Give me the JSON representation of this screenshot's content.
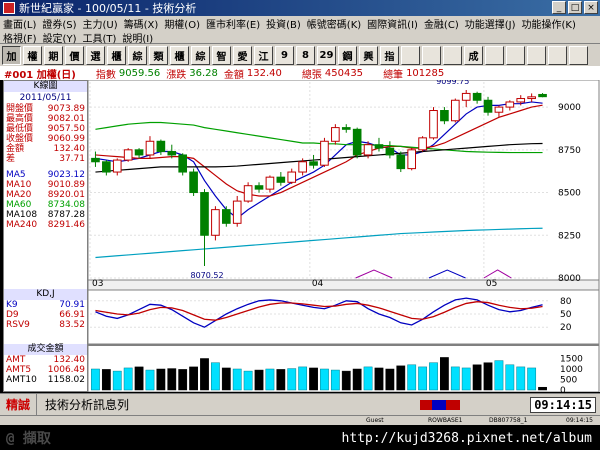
{
  "window": {
    "title": "新世紀贏家 - 100/05/11 - 技術分析",
    "controls": [
      "_",
      "□",
      "×"
    ]
  },
  "menu": {
    "row1": [
      "畫面(L)",
      "證券(S)",
      "主力(U)",
      "籌碼(X)",
      "期權(O)",
      "匯市利率(E)",
      "投資(B)",
      "帳號密碼(K)",
      "國際資訊(I)",
      "金融(C)",
      "功能選擇(J)",
      "功能操作(K)"
    ],
    "row2": [
      "格視(F)",
      "設定(Y)",
      "工具(T)",
      "說明(I)"
    ]
  },
  "toolbar": {
    "buttons": [
      "加",
      "權",
      "期",
      "價",
      "選",
      "櫃",
      "綜",
      "類",
      "櫃",
      "綜",
      "智",
      "愛",
      "江",
      "9",
      "8",
      "29",
      "鋼",
      "興",
      "指",
      "",
      "",
      "",
      "成",
      "",
      "",
      "",
      "",
      ""
    ]
  },
  "info": {
    "code": "#001 加權(日)",
    "index_label": "指數",
    "index_value": "9059.56",
    "change_label": "漲跌",
    "change_value": "36.28",
    "amount_label": "金額",
    "amount_value": "132.40",
    "vol_label": "總張",
    "vol_value": "450435",
    "trades_label": "總筆",
    "trades_value": "101285"
  },
  "k_panel": {
    "title": "K線圖",
    "date": "2011/05/11",
    "rows": [
      {
        "label": "開盤價",
        "value": "9073.89",
        "color": "#c00000"
      },
      {
        "label": "最高價",
        "value": "9082.01",
        "color": "#c00000"
      },
      {
        "label": "最低價",
        "value": "9057.50",
        "color": "#c00000"
      },
      {
        "label": "收盤價",
        "value": "9060.99",
        "color": "#c00000"
      },
      {
        "label": "金額",
        "value": "132.40",
        "color": "#c00000"
      },
      {
        "label": "差",
        "value": "37.71",
        "color": "#c00000"
      }
    ],
    "ma_rows": [
      {
        "label": "MA5",
        "value": "9023.12",
        "color": "#0000c0"
      },
      {
        "label": "MA10",
        "value": "9010.89",
        "color": "#c00000"
      },
      {
        "label": "MA20",
        "value": "8920.01",
        "color": "#c00000"
      },
      {
        "label": "MA60",
        "value": "8734.08",
        "color": "#00a000"
      },
      {
        "label": "MA108",
        "value": "8787.28",
        "color": "#000000"
      },
      {
        "label": "MA240",
        "value": "8291.46",
        "color": "#c00000"
      }
    ],
    "kd_title": "KD,J",
    "kd_rows": [
      {
        "label": "K9",
        "value": "70.91",
        "color": "#0000c0"
      },
      {
        "label": "D9",
        "value": "66.91",
        "color": "#c00000"
      },
      {
        "label": "RSV9",
        "value": "83.52",
        "color": "#c00000"
      }
    ],
    "vol_title": "成交金額",
    "vol_rows": [
      {
        "label": "AMT",
        "value": "132.40",
        "color": "#c00000"
      },
      {
        "label": "AMT5",
        "value": "1006.49",
        "color": "#c00000"
      },
      {
        "label": "AMT10",
        "value": "1158.02",
        "color": "#000000"
      }
    ]
  },
  "chart_data": [
    {
      "type": "candlestick",
      "title": "K線圖",
      "x_labels": [
        "03",
        "04",
        "05"
      ],
      "y_ticks": [
        8000,
        8250,
        8500,
        8750,
        9000
      ],
      "ylim": [
        8000,
        9100
      ],
      "annotations": [
        {
          "text": "9099.75"
        },
        {
          "text": "8070.52"
        }
      ],
      "candles": [
        [
          8700,
          8740,
          8650,
          8680
        ],
        [
          8680,
          8690,
          8600,
          8620
        ],
        [
          8620,
          8700,
          8600,
          8690
        ],
        [
          8690,
          8760,
          8680,
          8750
        ],
        [
          8750,
          8760,
          8700,
          8720
        ],
        [
          8720,
          8830,
          8700,
          8800
        ],
        [
          8800,
          8810,
          8720,
          8740
        ],
        [
          8740,
          8780,
          8700,
          8720
        ],
        [
          8720,
          8730,
          8600,
          8620
        ],
        [
          8620,
          8640,
          8480,
          8500
        ],
        [
          8500,
          8520,
          8070,
          8250
        ],
        [
          8250,
          8420,
          8220,
          8400
        ],
        [
          8400,
          8420,
          8300,
          8320
        ],
        [
          8320,
          8480,
          8300,
          8450
        ],
        [
          8450,
          8560,
          8440,
          8540
        ],
        [
          8540,
          8560,
          8500,
          8520
        ],
        [
          8520,
          8600,
          8500,
          8590
        ],
        [
          8590,
          8620,
          8540,
          8560
        ],
        [
          8560,
          8640,
          8550,
          8620
        ],
        [
          8620,
          8700,
          8600,
          8680
        ],
        [
          8680,
          8720,
          8640,
          8660
        ],
        [
          8660,
          8820,
          8650,
          8800
        ],
        [
          8800,
          8900,
          8780,
          8880
        ],
        [
          8880,
          8900,
          8850,
          8870
        ],
        [
          8870,
          8880,
          8700,
          8720
        ],
        [
          8720,
          8800,
          8700,
          8780
        ],
        [
          8780,
          8820,
          8740,
          8760
        ],
        [
          8760,
          8800,
          8700,
          8720
        ],
        [
          8720,
          8740,
          8620,
          8640
        ],
        [
          8640,
          8760,
          8630,
          8750
        ],
        [
          8750,
          8830,
          8740,
          8820
        ],
        [
          8820,
          9000,
          8810,
          8980
        ],
        [
          8980,
          9000,
          8900,
          8920
        ],
        [
          8920,
          9050,
          8910,
          9040
        ],
        [
          9040,
          9100,
          9000,
          9080
        ],
        [
          9080,
          9090,
          9020,
          9040
        ],
        [
          9040,
          9060,
          8950,
          8970
        ],
        [
          8970,
          9010,
          8940,
          9000
        ],
        [
          9000,
          9040,
          8980,
          9030
        ],
        [
          9030,
          9070,
          9010,
          9050
        ],
        [
          9050,
          9080,
          9030,
          9060
        ],
        [
          9073.89,
          9082.01,
          9057.5,
          9060.99
        ]
      ],
      "ma": [
        {
          "name": "MA5",
          "color": "#0000c0",
          "values": [
            8700,
            8690,
            8680,
            8690,
            8700,
            8720,
            8740,
            8740,
            8720,
            8680,
            8570,
            8480,
            8400,
            8350,
            8400,
            8440,
            8480,
            8520,
            8560,
            8590,
            8620,
            8660,
            8720,
            8780,
            8800,
            8790,
            8770,
            8760,
            8720,
            8720,
            8740,
            8780,
            8840,
            8900,
            8960,
            9000,
            9010,
            9010,
            9020,
            9020,
            9030,
            9023
          ]
        },
        {
          "name": "MA10",
          "color": "#c00000",
          "values": [
            8720,
            8715,
            8710,
            8705,
            8700,
            8700,
            8705,
            8710,
            8710,
            8700,
            8650,
            8600,
            8550,
            8510,
            8490,
            8480,
            8480,
            8500,
            8530,
            8560,
            8590,
            8620,
            8650,
            8680,
            8720,
            8740,
            8760,
            8770,
            8770,
            8760,
            8760,
            8770,
            8790,
            8820,
            8850,
            8880,
            8910,
            8940,
            8960,
            8980,
            9000,
            9011
          ]
        },
        {
          "name": "MA60",
          "color": "#00a000",
          "values": [
            8870,
            8880,
            8890,
            8900,
            8905,
            8910,
            8910,
            8905,
            8900,
            8895,
            8880,
            8870,
            8860,
            8850,
            8840,
            8830,
            8820,
            8810,
            8800,
            8790,
            8790,
            8785,
            8785,
            8780,
            8780,
            8780,
            8775,
            8775,
            8770,
            8765,
            8760,
            8755,
            8750,
            8745,
            8740,
            8738,
            8736,
            8735,
            8734,
            8734,
            8734,
            8734
          ]
        },
        {
          "name": "MA108",
          "color": "#000000",
          "values": [
            8620,
            8625,
            8630,
            8635,
            8640,
            8645,
            8650,
            8650,
            8650,
            8650,
            8650,
            8650,
            8652,
            8655,
            8660,
            8665,
            8670,
            8675,
            8680,
            8685,
            8690,
            8695,
            8700,
            8705,
            8710,
            8715,
            8720,
            8725,
            8730,
            8735,
            8740,
            8745,
            8750,
            8755,
            8760,
            8765,
            8770,
            8775,
            8780,
            8783,
            8786,
            8787
          ]
        },
        {
          "name": "MA240",
          "color": "#00a0c0",
          "values": [
            8120,
            8125,
            8130,
            8135,
            8140,
            8145,
            8150,
            8155,
            8160,
            8165,
            8170,
            8175,
            8180,
            8185,
            8190,
            8195,
            8200,
            8205,
            8210,
            8215,
            8220,
            8225,
            8230,
            8235,
            8240,
            8245,
            8250,
            8255,
            8260,
            8263,
            8266,
            8269,
            8272,
            8275,
            8278,
            8280,
            8282,
            8284,
            8286,
            8288,
            8290,
            8291
          ]
        }
      ]
    },
    {
      "type": "line",
      "title": "KD,J",
      "y_ticks": [
        20,
        50,
        80
      ],
      "ylim": [
        0,
        100
      ],
      "series": [
        {
          "name": "K9",
          "color": "#0000c0",
          "values": [
            55,
            45,
            40,
            48,
            60,
            72,
            70,
            60,
            45,
            30,
            20,
            35,
            50,
            62,
            72,
            80,
            82,
            80,
            75,
            70,
            65,
            62,
            70,
            80,
            78,
            62,
            50,
            42,
            30,
            25,
            38,
            55,
            70,
            82,
            86,
            82,
            70,
            60,
            55,
            58,
            65,
            71
          ]
        },
        {
          "name": "D9",
          "color": "#c00000",
          "values": [
            58,
            54,
            50,
            48,
            52,
            60,
            65,
            64,
            58,
            48,
            38,
            36,
            42,
            50,
            58,
            66,
            72,
            75,
            75,
            73,
            70,
            67,
            68,
            72,
            74,
            70,
            64,
            56,
            48,
            40,
            38,
            44,
            54,
            65,
            74,
            78,
            76,
            70,
            65,
            62,
            63,
            67
          ]
        }
      ]
    },
    {
      "type": "bar",
      "title": "成交金額",
      "y_ticks": [
        0,
        500,
        1000,
        1500
      ],
      "ylim": [
        0,
        2000
      ],
      "values": [
        1000,
        980,
        900,
        1050,
        1100,
        950,
        1000,
        1020,
        980,
        1100,
        1500,
        1300,
        1050,
        1000,
        900,
        950,
        1000,
        980,
        1020,
        1100,
        1050,
        1000,
        950,
        900,
        1000,
        1100,
        1050,
        1000,
        1150,
        1200,
        1100,
        1300,
        1550,
        1100,
        1050,
        1200,
        1300,
        1400,
        1200,
        1100,
        1050,
        132
      ],
      "up": [
        1,
        0,
        1,
        1,
        0,
        1,
        0,
        0,
        0,
        0,
        0,
        1,
        0,
        1,
        1,
        0,
        1,
        0,
        1,
        1,
        0,
        1,
        1,
        0,
        0,
        1,
        0,
        0,
        0,
        1,
        1,
        1,
        0,
        1,
        1,
        0,
        0,
        1,
        1,
        1,
        1,
        0
      ]
    }
  ],
  "status": {
    "left_label": "精誠",
    "feed_label": "技術分析訊息列",
    "clock": "09:14:15"
  },
  "bottom": {
    "user": "Guest",
    "server": "ROWBASE1",
    "code": "DB807758_1",
    "time": "09:14:15"
  },
  "watermark": {
    "url": "http://kujd3268.pixnet.net/album",
    "text": "@ 擷取"
  }
}
